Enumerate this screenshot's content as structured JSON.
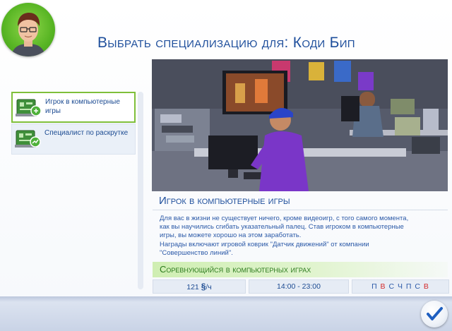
{
  "dialog": {
    "title": "Выбрать специализацию для: Коди Бип"
  },
  "sim": {
    "avatar_icon": "sim-portrait"
  },
  "careers": [
    {
      "label": "Игрок в компьютерные игры",
      "icon": "gaming-circuit-board-icon",
      "selected": true
    },
    {
      "label": "Специалист по раскрутке",
      "icon": "marketing-circuit-board-icon",
      "selected": false
    }
  ],
  "details": {
    "heading": "Игрок в компьютерные игры",
    "description_line1": "Для вас в жизни не существует ничего, кроме видеоигр, с того самого момента,",
    "description_line2": "как вы научились сгибать указательный палец. Став игроком в компьютерные",
    "description_line3": "игры, вы можете хорошо на этом заработать.",
    "description_line4": "Награды включают игровой коврик \"Датчик движений\" от компании",
    "description_line5": "\"Совершенство линий\".",
    "level_name": "Соревнующийся в компьютерных играх",
    "pay_amount": "121",
    "pay_currency": "§",
    "pay_unit": "/ч",
    "hours": "14:00 - 23:00",
    "days": [
      {
        "letter": "П",
        "off": false
      },
      {
        "letter": "В",
        "off": true
      },
      {
        "letter": "С",
        "off": false
      },
      {
        "letter": "Ч",
        "off": false
      },
      {
        "letter": "П",
        "off": false
      },
      {
        "letter": "С",
        "off": false
      },
      {
        "letter": "В",
        "off": true
      }
    ]
  },
  "colors": {
    "title_blue": "#1f4f9c",
    "text_blue": "#2c5aa8",
    "level_green": "#2b7a1c",
    "day_off_red": "#d42a2a",
    "selected_border": "#7fbf3a"
  },
  "confirm_icon": "checkmark-icon"
}
